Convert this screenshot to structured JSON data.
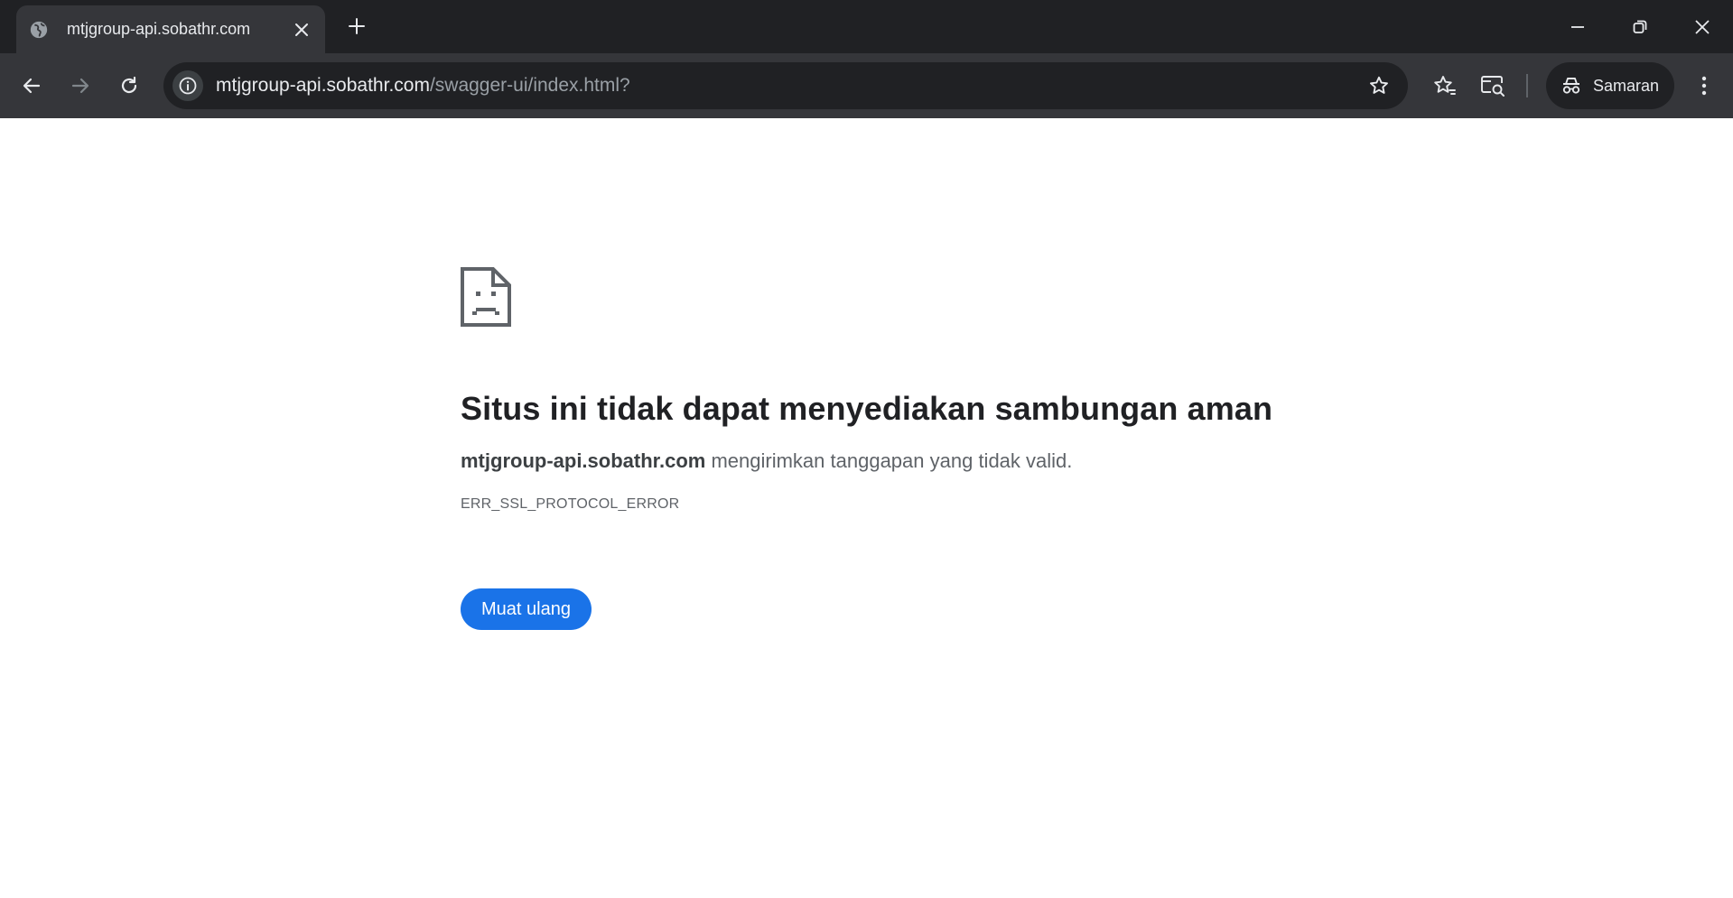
{
  "tab": {
    "title": "mtjgroup-api.sobathr.com",
    "favicon": "globe-icon"
  },
  "toolbar": {
    "url_host": "mtjgroup-api.sobathr.com",
    "url_path": "/swagger-ui/index.html?",
    "profile_label": "Samaran"
  },
  "error": {
    "icon": "sad-document-icon",
    "title": "Situs ini tidak dapat menyediakan sambungan aman",
    "host": "mtjgroup-api.sobathr.com",
    "message": " mengirimkan tanggapan yang tidak valid.",
    "code": "ERR_SSL_PROTOCOL_ERROR",
    "reload_label": "Muat ulang"
  },
  "colors": {
    "tabstrip": "#202124",
    "toolbar": "#35363a",
    "accent": "#1a73e8",
    "page_background": "#ffffff"
  }
}
